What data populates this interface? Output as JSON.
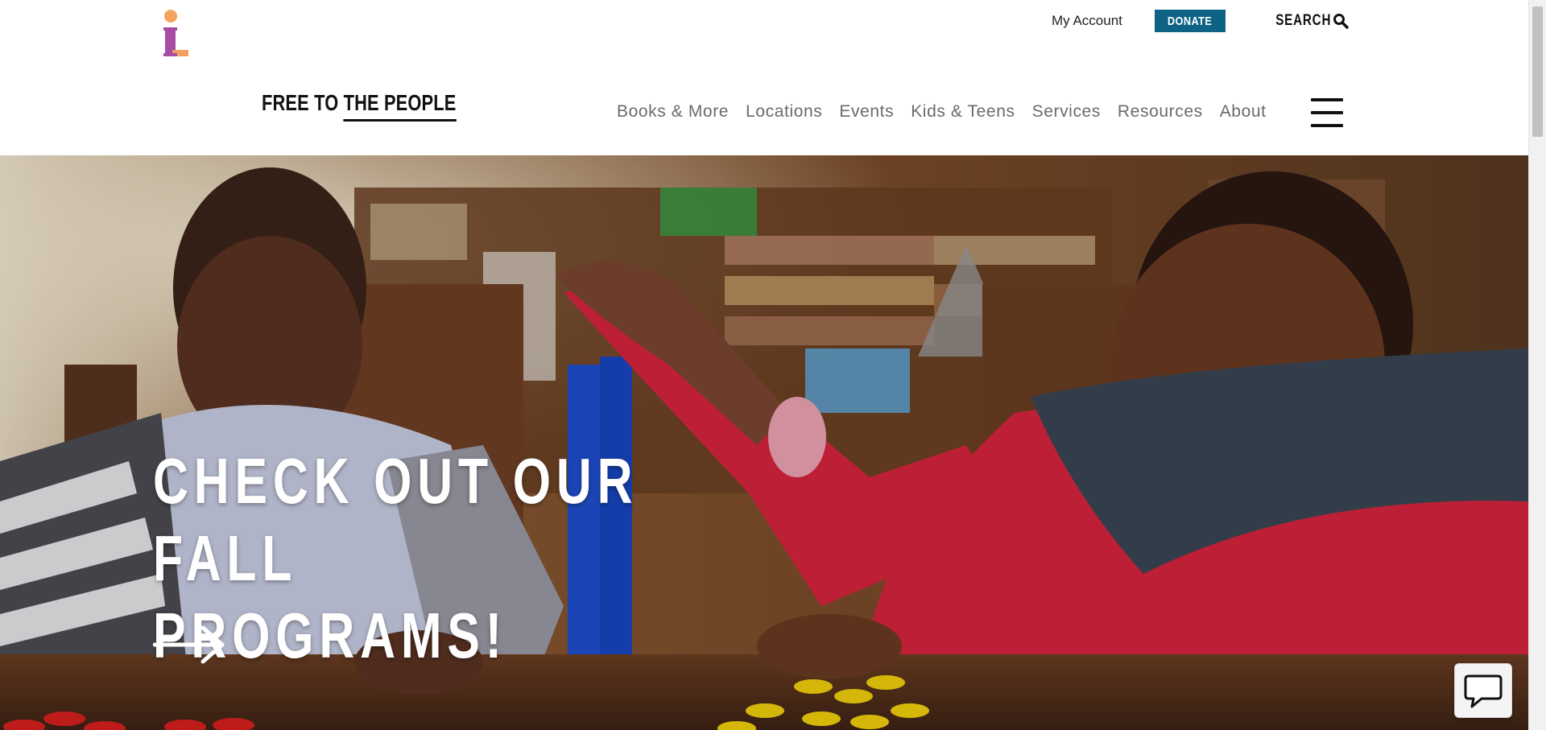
{
  "header": {
    "tagline_part1": "FREE TO",
    "tagline_part2": "THE PEOPLE",
    "account_link": "My Account",
    "donate_label": "DONATE",
    "search_label": "SEARCH"
  },
  "nav": {
    "items": [
      "Books & More",
      "Locations",
      "Events",
      "Kids & Teens",
      "Services",
      "Resources",
      "About"
    ]
  },
  "hero": {
    "heading_line1": "CHECK OUT OUR FALL",
    "heading_line2": "PROGRAMS!"
  },
  "colors": {
    "donate_bg": "#0e6283",
    "logo_dot": "#f4a460",
    "logo_letter_purple": "#a64ca6",
    "logo_letter_orange": "#f29a5a"
  },
  "icons": {
    "logo": "library-logo",
    "search": "magnifier-icon",
    "menu": "hamburger-icon",
    "hero_arrow": "right-arrow-icon",
    "chat": "chat-bubble-icon"
  }
}
